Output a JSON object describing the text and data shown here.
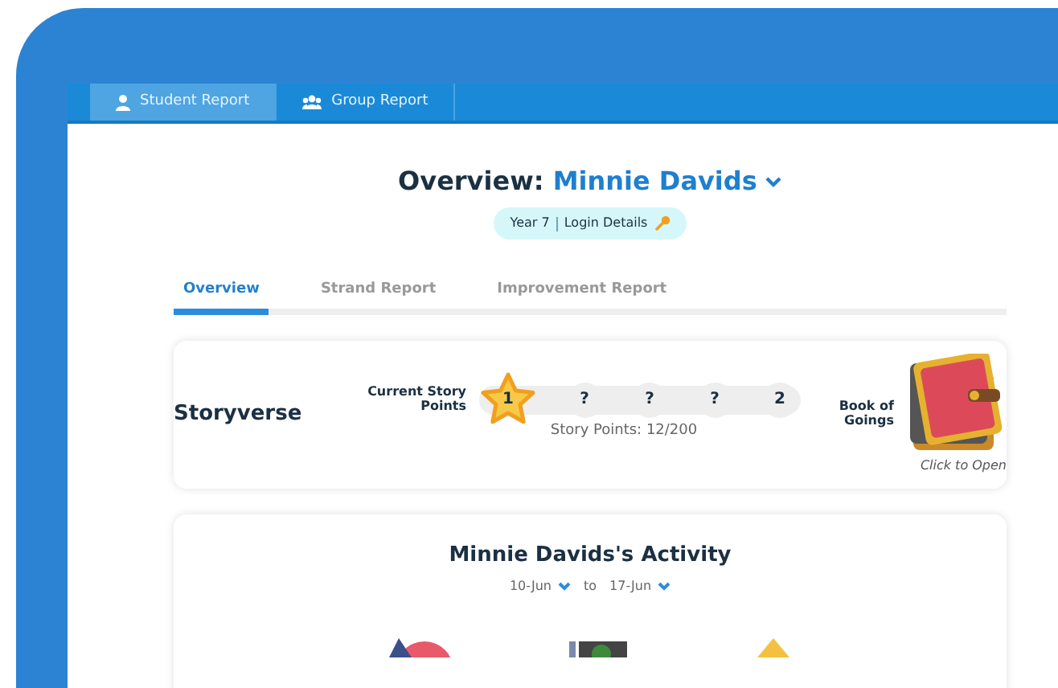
{
  "nav_tabs": [
    {
      "label": "Student Report",
      "kind": "person",
      "selected": true
    },
    {
      "label": "Group Report",
      "kind": "group",
      "selected": false
    }
  ],
  "header": {
    "title": "Overview:",
    "student": "Minnie Davids",
    "year": "Year 7",
    "login": "Login Details"
  },
  "report_tabs": [
    {
      "label": "Overview",
      "selected": true
    },
    {
      "label": "Strand Report",
      "selected": false
    },
    {
      "label": "Improvement Report",
      "selected": false
    }
  ],
  "storyverse": {
    "title": "Storyverse",
    "points_label": "Current Story Points",
    "milestones": [
      {
        "label": "1",
        "achieved": true
      },
      {
        "label": "?",
        "achieved": false
      },
      {
        "label": "?",
        "achieved": false
      },
      {
        "label": "?",
        "achieved": false
      },
      {
        "label": "2",
        "achieved": false
      }
    ],
    "points": "Story Points: 12/200",
    "book_label": "Book of Goings",
    "book_hint": "Click to Open"
  },
  "activity": {
    "title": "Minnie Davids's Activity",
    "from": "10-Jun",
    "joiner": "to",
    "to": "17-Jun"
  }
}
